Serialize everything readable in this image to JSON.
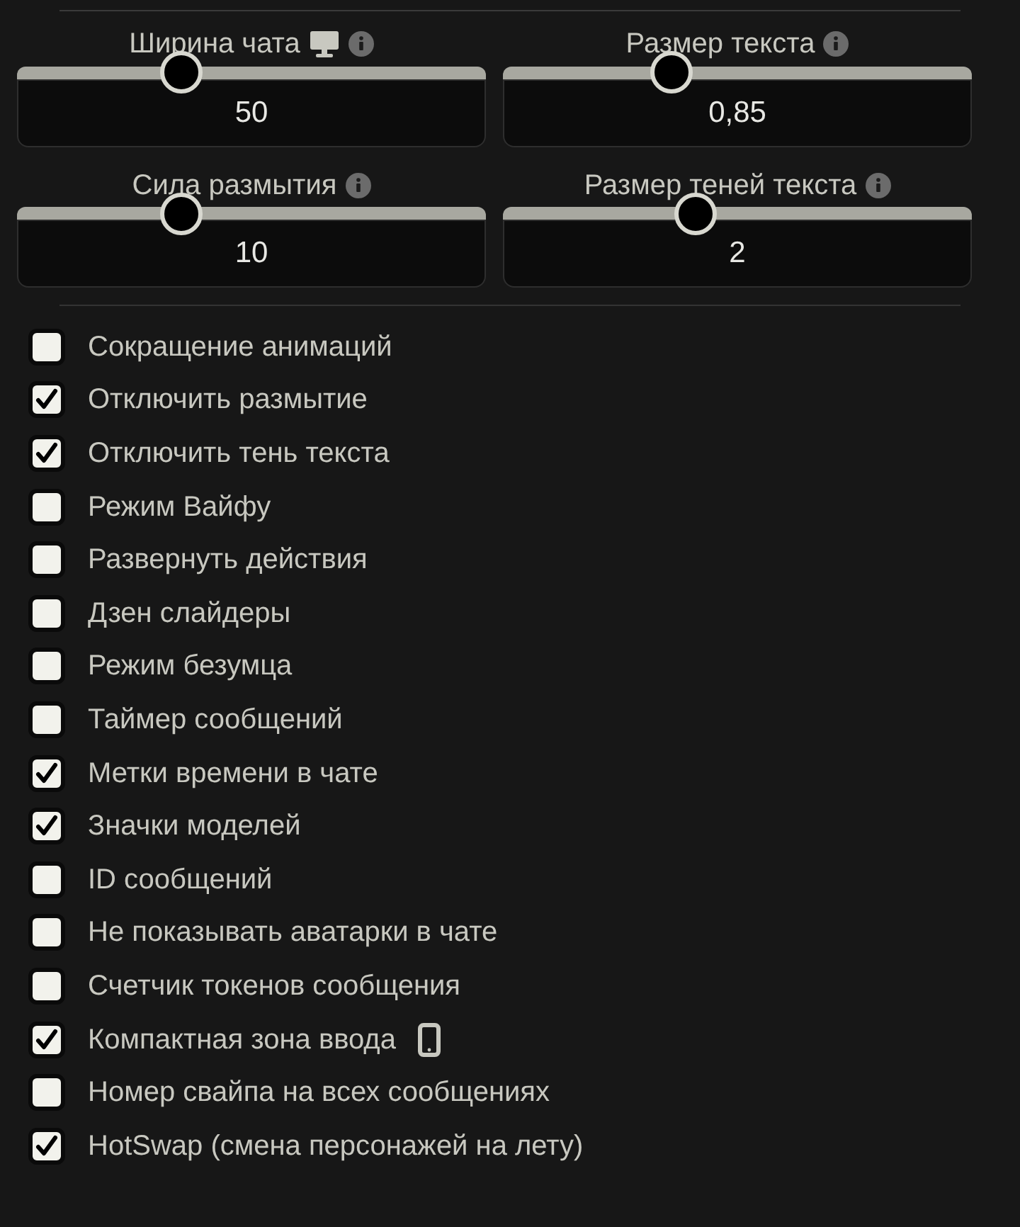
{
  "sliders": [
    {
      "label": "Ширина чата",
      "kind": "desktop-only",
      "level": 0.35,
      "value": "50"
    },
    {
      "label": "Размер текста",
      "kind": "plain",
      "level": 0.36,
      "value": "0,85"
    },
    {
      "label": "Сила размытия",
      "kind": "plain",
      "level": 0.35,
      "value": "10"
    },
    {
      "label": "Размер теней текста",
      "kind": "plain",
      "level": 0.41,
      "value": "2"
    }
  ],
  "options": [
    {
      "label": "Сокращение анимаций",
      "checked": false,
      "kind": "plain"
    },
    {
      "label": "Отключить размытие",
      "checked": true,
      "kind": "plain"
    },
    {
      "label": "Отключить тень текста",
      "checked": true,
      "kind": "plain"
    },
    {
      "label": "Режим Вайфу",
      "checked": false,
      "kind": "plain"
    },
    {
      "label": "Развернуть действия",
      "checked": false,
      "kind": "plain"
    },
    {
      "label": "Дзен слайдеры",
      "checked": false,
      "kind": "plain"
    },
    {
      "label": "Режим безумца",
      "checked": false,
      "kind": "plain"
    },
    {
      "label": "Таймер сообщений",
      "checked": false,
      "kind": "plain"
    },
    {
      "label": "Метки времени в чате",
      "checked": true,
      "kind": "plain"
    },
    {
      "label": "Значки моделей",
      "checked": true,
      "kind": "plain"
    },
    {
      "label": "ID сообщений",
      "checked": false,
      "kind": "plain"
    },
    {
      "label": "Не показывать аватарки в чате",
      "checked": false,
      "kind": "plain"
    },
    {
      "label": "Счетчик токенов сообщения",
      "checked": false,
      "kind": "plain"
    },
    {
      "label": "Компактная зона ввода",
      "checked": true,
      "kind": "mobile-only"
    },
    {
      "label": "Номер свайпа на всех сообщениях",
      "checked": false,
      "kind": "plain"
    },
    {
      "label": "HotSwap (смена персонажей на лету)",
      "checked": true,
      "kind": "plain"
    }
  ]
}
